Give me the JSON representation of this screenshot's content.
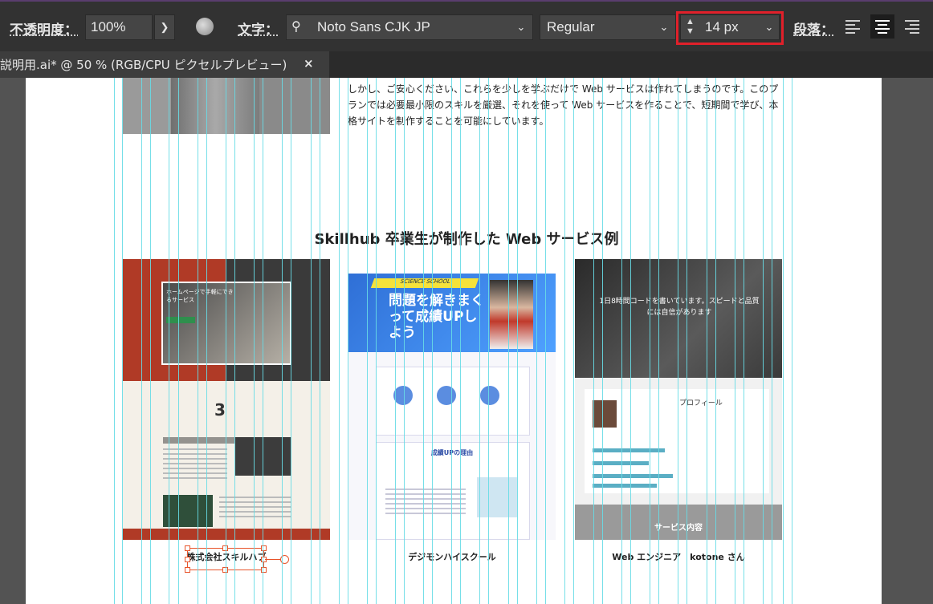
{
  "toolbar": {
    "opacity_label": "不透明度：",
    "opacity_value": "100%",
    "character_label": "文字：",
    "font_family": "Noto Sans CJK JP",
    "font_style": "Regular",
    "font_size": "14 px",
    "paragraph_label": "段落："
  },
  "document_tab": {
    "title": "説明用.ai* @ 50 % (RGB/CPU ピクセルプレビュー)",
    "close": "×"
  },
  "artboard": {
    "intro_text": "しかし、ご安心ください、これらを少しを学ぶだけで Web サービスは作れてしまうのです。このプランでは必要最小限のスキルを厳選、それを使って Web サービスを作ることで、短期間で学び、本格サイトを制作することを可能にしています。",
    "section_title": "Skillhub 卒業生が制作した Web サービス例",
    "cards": [
      {
        "caption": "株式会社スキルハブ",
        "hero_text": "ホームページで手軽にできるサービス",
        "number": "3"
      },
      {
        "caption": "デジモンハイスクール",
        "banner": "問題を解きまくって成績UPしよう",
        "ribbon": "SCIENCE SCHOOL",
        "sub": "成績UPの理由"
      },
      {
        "caption": "Web エンジニア　kotone さん",
        "hero_text": "1日8時間コードを書いています。スピードと品質には自信があります",
        "profile": "プロフィール",
        "service": "サービス内容"
      }
    ]
  },
  "colors": {
    "toolbar_bg": "#323232",
    "highlight": "#e0202a",
    "guide": "#67dbe6",
    "selection": "#e8542a"
  }
}
